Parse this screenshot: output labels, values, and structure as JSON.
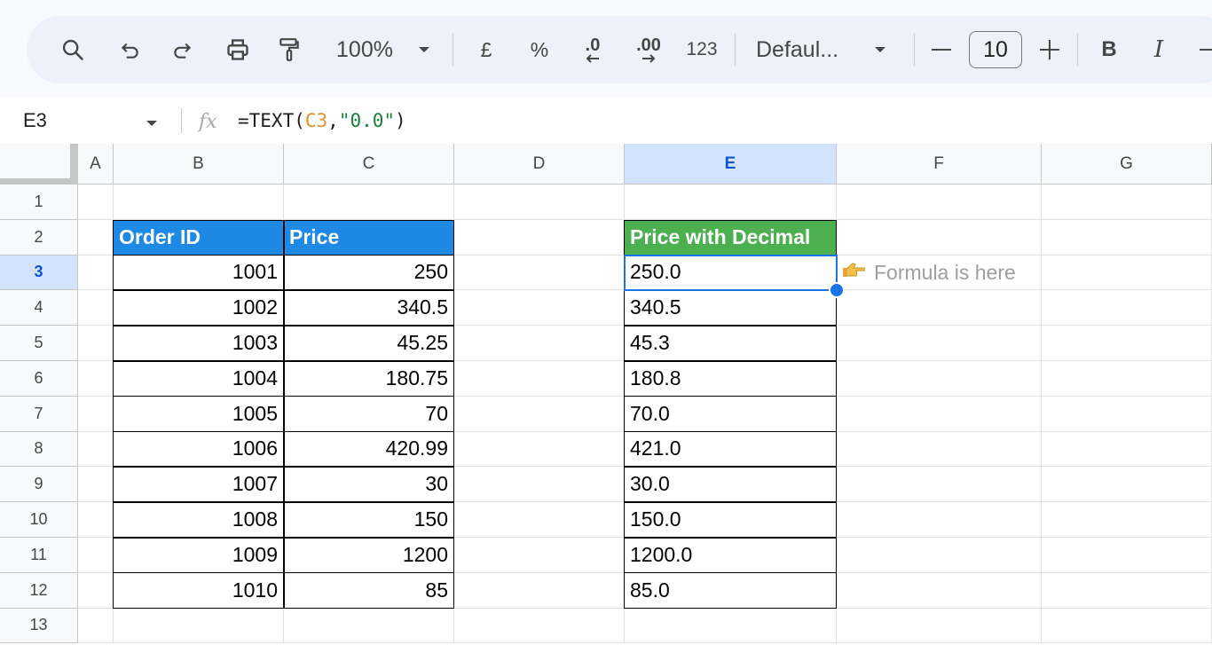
{
  "toolbar": {
    "zoom": "100%",
    "currency": "£",
    "percent": "%",
    "dec_decrease": ".0",
    "dec_increase": ".00",
    "number_format": "123",
    "font": "Defaul...",
    "font_size": "10",
    "bold": "B",
    "italic": "I"
  },
  "formula_bar": {
    "name_box": "E3",
    "formula_prefix": "=TEXT(",
    "formula_ref": "C3",
    "formula_comma": ",",
    "formula_string": "\"0.0\"",
    "formula_suffix": ")"
  },
  "columns": [
    "A",
    "B",
    "C",
    "D",
    "E",
    "F",
    "G"
  ],
  "rows": [
    "1",
    "2",
    "3",
    "4",
    "5",
    "6",
    "7",
    "8",
    "9",
    "10",
    "11",
    "12",
    "13"
  ],
  "selected": {
    "column": "E",
    "row": "3"
  },
  "table": {
    "headers": {
      "order_id": "Order ID",
      "price": "Price",
      "price_decimal": "Price with Decimal"
    },
    "order_ids": [
      "1001",
      "1002",
      "1003",
      "1004",
      "1005",
      "1006",
      "1007",
      "1008",
      "1009",
      "1010"
    ],
    "prices": [
      "250",
      "340.5",
      "45.25",
      "180.75",
      "70",
      "420.99",
      "30",
      "150",
      "1200",
      "85"
    ],
    "prices_decimal": [
      "250.0",
      "340.5",
      "45.3",
      "180.8",
      "70.0",
      "421.0",
      "30.0",
      "150.0",
      "1200.0",
      "85.0"
    ]
  },
  "note": {
    "icon": "pointing-hand-icon",
    "text": "Formula is here"
  },
  "colors": {
    "header_blue": "#1e88e5",
    "header_green": "#4caf50",
    "selection": "#1a73e8",
    "formula_ref": "#e3902b",
    "formula_string": "#188038"
  }
}
